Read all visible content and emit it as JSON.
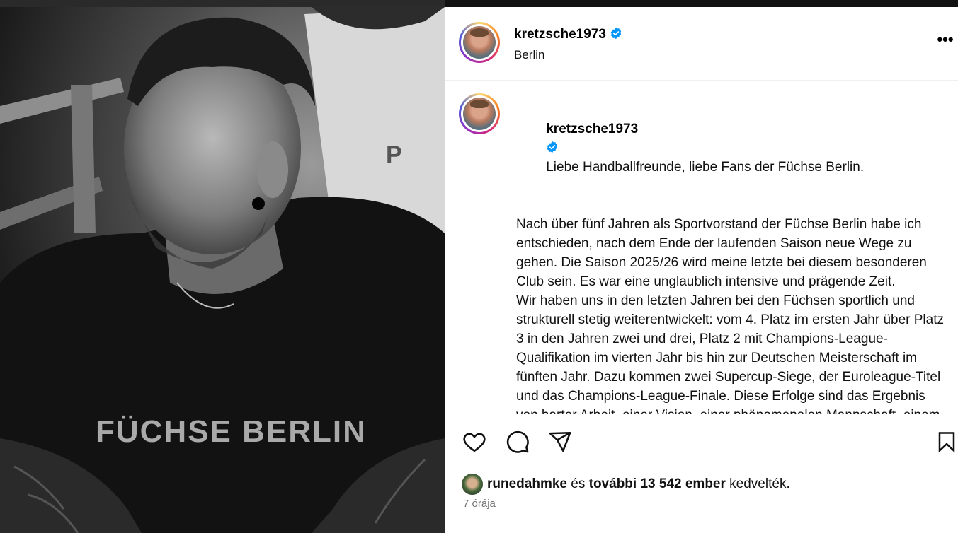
{
  "post": {
    "author": "kretzsche1973",
    "location": "Berlin",
    "more_label": "•••",
    "caption_intro": "Liebe Handballfreunde, liebe Fans der Füchse Berlin.",
    "caption_body": "Nach über fünf Jahren als Sportvorstand der Füchse Berlin habe ich entschieden, nach dem Ende der laufenden Saison neue Wege zu gehen. Die Saison 2025/26 wird meine letzte bei diesem besonderen Club sein. Es war eine unglaublich intensive und prägende Zeit.\nWir haben uns in den letzten Jahren bei den Füchsen sportlich und strukturell stetig weiterentwickelt: vom 4. Platz im ersten Jahr über Platz 3 in den Jahren zwei und drei, Platz 2 mit Champions-League-Qualifikation im vierten Jahr bis hin zur Deutschen Meisterschaft im fünften Jahr. Dazu kommen zwei Supercup-Siege, der Euroleague-Titel und das Champions-League-Finale. Diese Erfolge sind das Ergebnis von harter Arbeit, einer Vision, einer phänomenalen Mannschaft, einem großartigen Trainerteam und unseren leidenschaftlichen Fans. Es",
    "photo_shirt_text": "FÜCHSE BERLIN"
  },
  "likes": {
    "first_liker": "runedahmke",
    "connector": "és",
    "others": "további 13 542 ember",
    "suffix": "kedvelték."
  },
  "timestamp": "7 órája",
  "icons": {
    "like": "heart-icon",
    "comment": "comment-icon",
    "share": "share-icon",
    "save": "bookmark-icon",
    "verified": "verified-badge-icon",
    "more": "more-options-icon"
  },
  "colors": {
    "verified": "#0095f6",
    "muted": "#737373"
  }
}
